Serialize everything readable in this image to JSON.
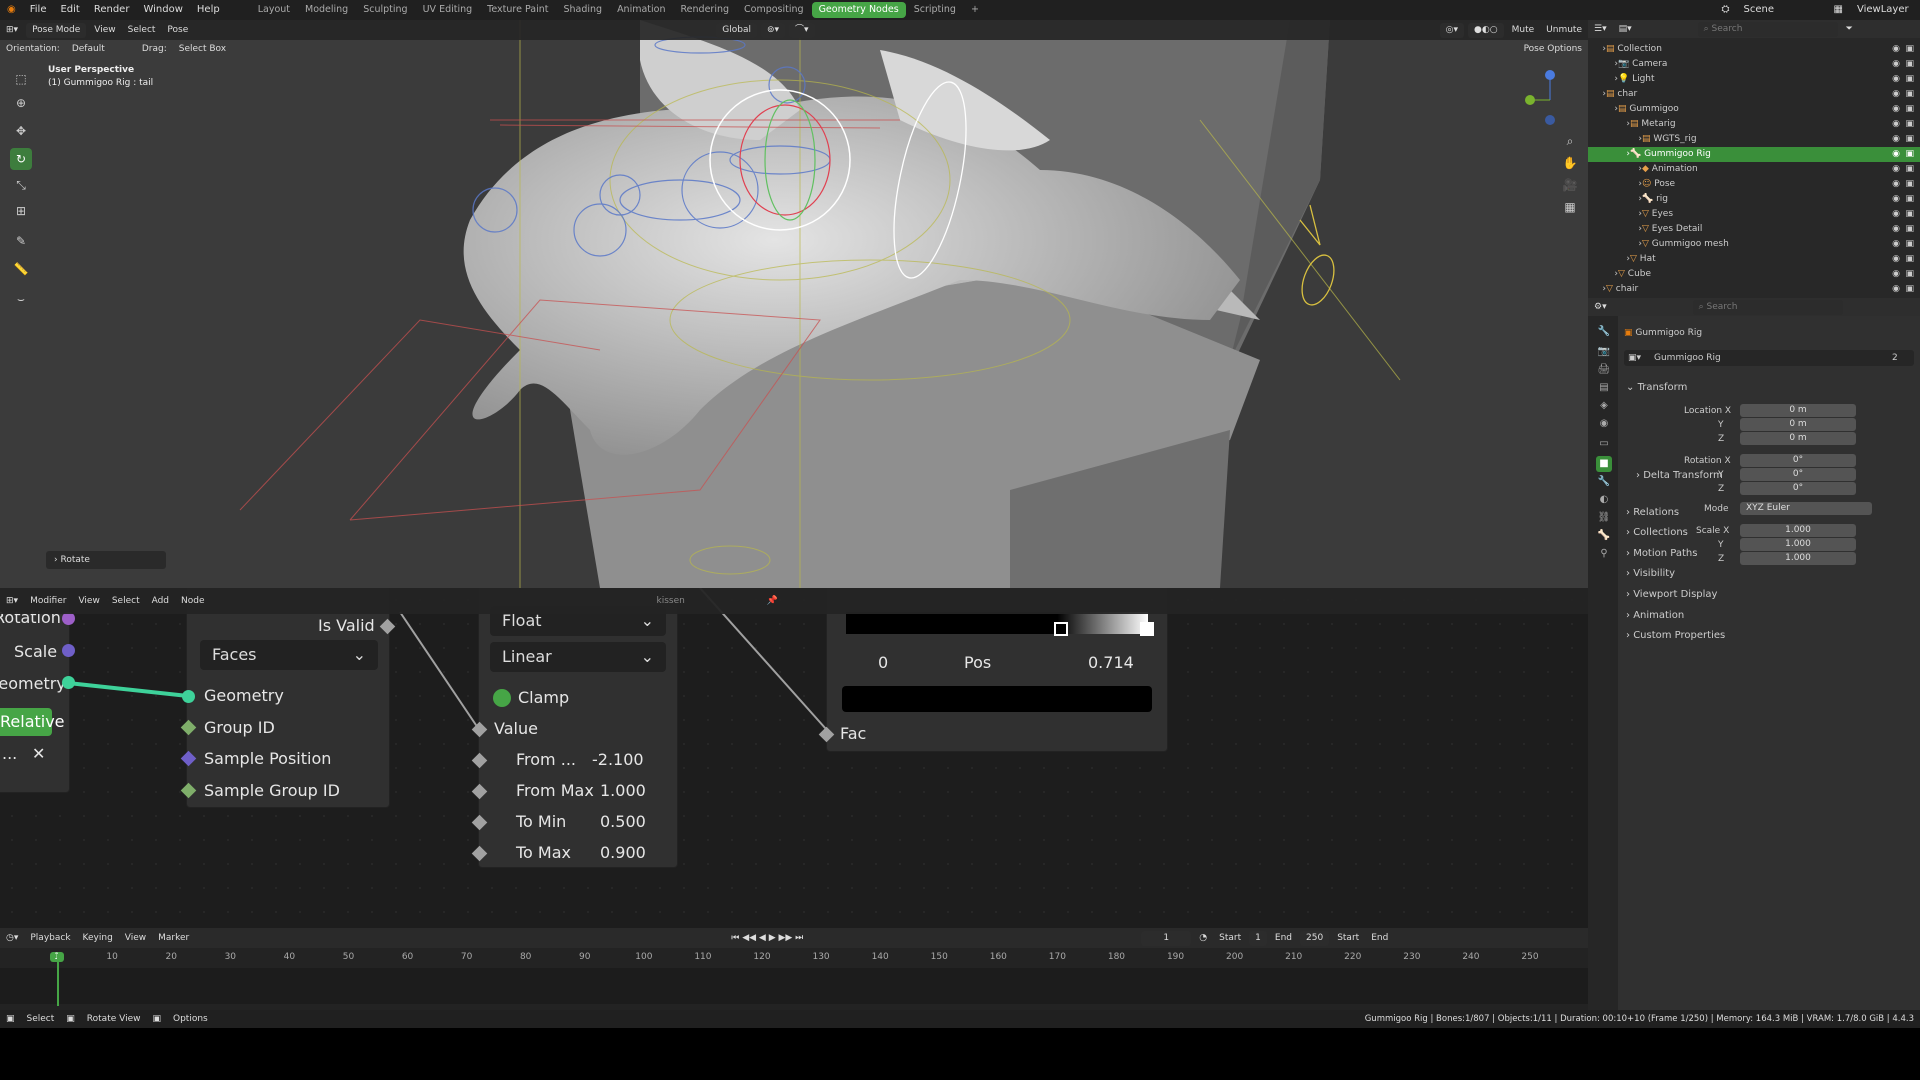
{
  "topbar": {
    "menus": [
      "File",
      "Edit",
      "Render",
      "Window",
      "Help"
    ],
    "workspaces": [
      "Layout",
      "Modeling",
      "Sculpting",
      "UV Editing",
      "Texture Paint",
      "Shading",
      "Animation",
      "Rendering",
      "Compositing",
      "Geometry Nodes",
      "Scripting"
    ],
    "active_workspace": "Geometry Nodes",
    "scene": "Scene",
    "view_layer": "ViewLayer"
  },
  "viewport": {
    "mode": "Pose Mode",
    "menus": [
      "View",
      "Select",
      "Pose"
    ],
    "orientation_label": "Orientation:",
    "orientation_value": "Default",
    "drag_label": "Drag:",
    "drag_value": "Select Box",
    "transform": "Global",
    "mute": "Mute",
    "unmute": "Unmute",
    "pose_options": "Pose Options",
    "info_title": "User Perspective",
    "info_sub": "(1) Gummigoo Rig : tail",
    "operator_panel": "Rotate"
  },
  "node_editor": {
    "editor_type": "Modifier",
    "menus": [
      "View",
      "Select",
      "Add",
      "Node"
    ],
    "object_name": "kissen",
    "left_node": {
      "rotation": "Rotation",
      "scale": "Scale",
      "geometry": "Geometry",
      "relative": "Relative",
      "ellipsis": "..."
    },
    "sample_node": {
      "is_valid": "Is Valid",
      "domain": "Faces",
      "geometry": "Geometry",
      "group_id": "Group ID",
      "sample_position": "Sample Position",
      "sample_group_id": "Sample Group ID"
    },
    "map_range_node": {
      "data_type": "Float",
      "interpolation": "Linear",
      "clamp": "Clamp",
      "value": "Value",
      "from_min_label": "From ...",
      "from_min": "-2.100",
      "from_max_label": "From Max",
      "from_max": "1.000",
      "to_min_label": "To Min",
      "to_min": "0.500",
      "to_max_label": "To Max",
      "to_max": "0.900"
    },
    "color_ramp_node": {
      "index": "0",
      "pos_label": "Pos",
      "pos": "0.714",
      "fac": "Fac"
    }
  },
  "timeline": {
    "menus": [
      "Playback",
      "Keying",
      "View",
      "Marker"
    ],
    "current_frame": "1",
    "start_label": "Start",
    "start": "1",
    "end_label": "End",
    "end": "250",
    "start_btn": "Start",
    "end_btn": "End",
    "ticks": [
      "1",
      "10",
      "20",
      "30",
      "40",
      "50",
      "60",
      "70",
      "80",
      "90",
      "100",
      "110",
      "120",
      "130",
      "140",
      "150",
      "160",
      "170",
      "180",
      "190",
      "200",
      "210",
      "220",
      "230",
      "240",
      "250"
    ]
  },
  "statusbar": {
    "select": "Select",
    "rotate_view": "Rotate View",
    "options": "Options",
    "info": "Gummigoo Rig | Bones:1/807 | Objects:1/11 | Duration: 00:10+10 (Frame 1/250) | Memory: 164.3 MiB | VRAM: 1.7/8.0 GiB | 4.4.3"
  },
  "outliner": {
    "search_placeholder": "Search",
    "items": [
      {
        "label": "Collection",
        "indent": 0,
        "icon": "▤"
      },
      {
        "label": "Camera",
        "indent": 1,
        "icon": "📷"
      },
      {
        "label": "Light",
        "indent": 1,
        "icon": "💡"
      },
      {
        "label": "char",
        "indent": 0,
        "icon": "▤"
      },
      {
        "label": "Gummigoo",
        "indent": 1,
        "icon": "▤"
      },
      {
        "label": "Metarig",
        "indent": 2,
        "icon": "▤"
      },
      {
        "label": "WGTS_rig",
        "indent": 3,
        "icon": "▤"
      },
      {
        "label": "Gummigoo Rig",
        "indent": 2,
        "icon": "🦴",
        "selected": true
      },
      {
        "label": "Animation",
        "indent": 3,
        "icon": "◆"
      },
      {
        "label": "Pose",
        "indent": 3,
        "icon": "☺"
      },
      {
        "label": "rig",
        "indent": 3,
        "icon": "🦴"
      },
      {
        "label": "Eyes",
        "indent": 3,
        "icon": "▽"
      },
      {
        "label": "Eyes Detail",
        "indent": 3,
        "icon": "▽"
      },
      {
        "label": "Gummigoo mesh",
        "indent": 3,
        "icon": "▽"
      },
      {
        "label": "Hat",
        "indent": 2,
        "icon": "▽"
      },
      {
        "label": "Cube",
        "indent": 1,
        "icon": "▽"
      },
      {
        "label": "chair",
        "indent": 0,
        "icon": "▽"
      }
    ]
  },
  "properties": {
    "search_placeholder": "Search",
    "object_name": "Gummigoo Rig",
    "data_name": "Gummigoo Rig",
    "users": "2",
    "transform": "Transform",
    "location_label": "Location X",
    "loc": [
      "0 m",
      "0 m",
      "0 m"
    ],
    "rotation_label": "Rotation X",
    "rot": [
      "0°",
      "0°",
      "0°"
    ],
    "mode_label": "Mode",
    "mode_value": "XYZ Euler",
    "scale_label": "Scale X",
    "scale": [
      "1.000",
      "1.000",
      "1.000"
    ],
    "y": "Y",
    "z": "Z",
    "sections": [
      "Delta Transform",
      "Relations",
      "Collections",
      "Motion Paths",
      "Visibility",
      "Viewport Display",
      "Animation",
      "Custom Properties"
    ]
  },
  "colors": {
    "accent": "#46a546",
    "selection": "#3a8f3a",
    "geometry_socket": "#3ed29a",
    "vector_socket": "#6f5fc8"
  }
}
